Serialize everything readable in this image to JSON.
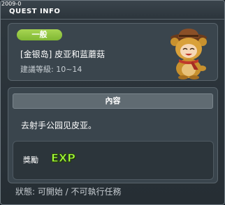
{
  "header": {
    "stamp": "2009-0",
    "title": "QUEST INFO"
  },
  "quest": {
    "category": "一般",
    "name": "[金银岛] 皮亚和蓝蘑菇",
    "level": "建議等級: 10~14",
    "npc_portrait": "bear-costume-npc-icon"
  },
  "content": {
    "header": "內容",
    "description": "去射手公园见皮亚。"
  },
  "reward": {
    "label": "獎勵",
    "icon": "exp-icon",
    "exp_text": "EXP"
  },
  "status": {
    "text": "狀態:  可開始 / 不可執行任務"
  },
  "colors": {
    "badge_green": "#8cc63f",
    "exp_green": "#a6ff3a",
    "window_bg": "#2a3238"
  }
}
